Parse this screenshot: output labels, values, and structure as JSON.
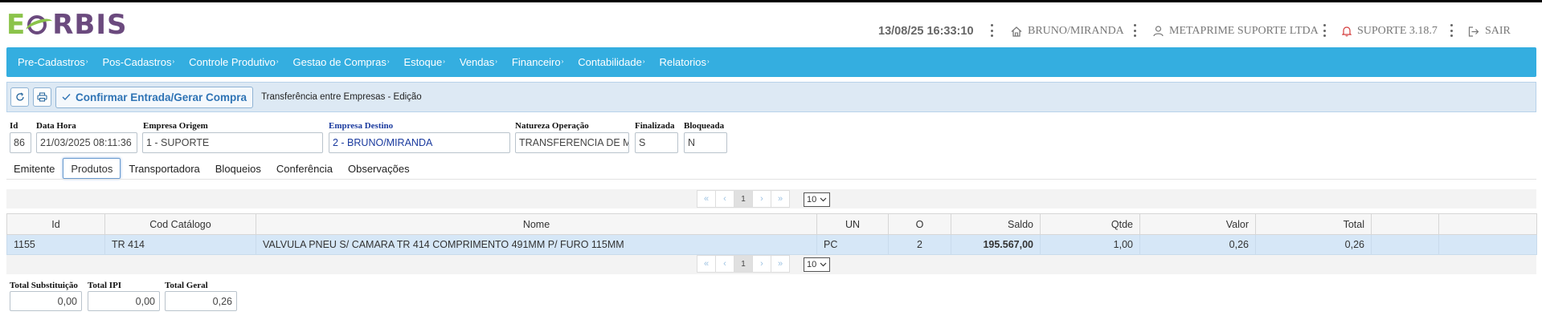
{
  "logo": {
    "e": "E",
    "rest": "RBIS"
  },
  "header": {
    "datetime": "13/08/25 16:33:10",
    "branch": "BRUNO/MIRANDA",
    "user": "METAPRIME SUPORTE LTDA",
    "version": "SUPORTE 3.18.7",
    "logout": "SAIR"
  },
  "menu": [
    "Pre-Cadastros",
    "Pos-Cadastros",
    "Controle Produtivo",
    "Gestao de Compras",
    "Estoque",
    "Vendas",
    "Financeiro",
    "Contabilidade",
    "Relatorios"
  ],
  "toolbar": {
    "confirm_label": "Confirmar Entrada/Gerar Compra",
    "title": "Transferência entre Empresas - Edição"
  },
  "fields": {
    "id": {
      "label": "Id",
      "value": "86"
    },
    "datahora": {
      "label": "Data Hora",
      "value": "21/03/2025 08:11:36"
    },
    "origem": {
      "label": "Empresa Origem",
      "value": "1 - SUPORTE"
    },
    "destino": {
      "label": "Empresa Destino",
      "value": "2 - BRUNO/MIRANDA"
    },
    "natureza": {
      "label": "Natureza Operação",
      "value": "TRANSFERENCIA DE MERC"
    },
    "finalizada": {
      "label": "Finalizada",
      "value": "S"
    },
    "bloqueada": {
      "label": "Bloqueada",
      "value": "N"
    }
  },
  "tabs": [
    "Emitente",
    "Produtos",
    "Transportadora",
    "Bloqueios",
    "Conferência",
    "Observações"
  ],
  "active_tab": "Produtos",
  "pager": {
    "first": "«",
    "prev": "‹",
    "page": "1",
    "next": "›",
    "last": "»",
    "page_size": "10"
  },
  "grid": {
    "columns": [
      "Id",
      "Cod Catálogo",
      "Nome",
      "UN",
      "O",
      "Saldo",
      "Qtde",
      "Valor",
      "Total",
      "",
      ""
    ],
    "rows": [
      {
        "id": "1155",
        "cod": "TR 414",
        "nome": "VALVULA PNEU S/ CAMARA TR 414 COMPRIMENTO 491MM P/ FURO 115MM",
        "un": "PC",
        "o": "2",
        "saldo": "195.567,00",
        "qtde": "1,00",
        "valor": "0,26",
        "total": "0,26"
      }
    ]
  },
  "totals": {
    "substituicao": {
      "label": "Total Substituição",
      "value": "0,00"
    },
    "ipi": {
      "label": "Total IPI",
      "value": "0,00"
    },
    "geral": {
      "label": "Total Geral",
      "value": "0,26"
    }
  },
  "colors": {
    "menu_bg": "#34aee0",
    "toolbar_bg": "#dde9f4",
    "row_selected": "#d6e7f7",
    "saldo": "#1f7ab5",
    "logo_green": "#8bc34a",
    "logo_purple": "#6b4a7e"
  }
}
